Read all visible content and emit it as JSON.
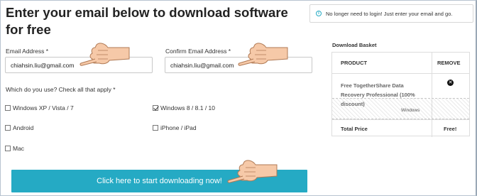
{
  "title": "Enter your email below to download software for free",
  "email": {
    "label": "Email Address *",
    "value": "chiahsin.liu@gmail.com",
    "confirm_label": "Confirm Email Address *",
    "confirm_value": "chiahsin.liu@gmail.com"
  },
  "question": "Which do you use? Check all that apply *",
  "options": [
    {
      "label": "Windows XP / Vista / 7",
      "checked": false
    },
    {
      "label": "Windows 8 / 8.1 / 10",
      "checked": true
    },
    {
      "label": "Android",
      "checked": false
    },
    {
      "label": "iPhone / iPad",
      "checked": false
    },
    {
      "label": "Mac",
      "checked": false
    }
  ],
  "download_button": "Click here to start downloading now!",
  "notice": "No longer need to login! Just enter your email and go.",
  "basket": {
    "title": "Download Basket",
    "col_product": "PRODUCT",
    "col_remove": "REMOVE",
    "product_name": "Free TogetherShare Data Recovery Professional (100% discount)",
    "platform": "Windows",
    "total_label": "Total Price",
    "total_value": "Free!"
  },
  "colors": {
    "accent": "#25aac4",
    "hand": "#f6c9a8"
  }
}
